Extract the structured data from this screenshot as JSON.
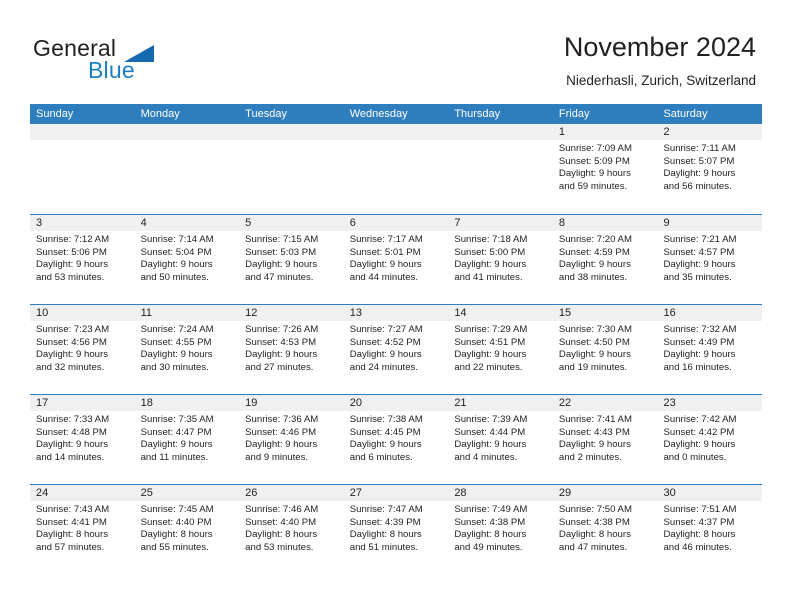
{
  "brand": {
    "word_one": "General",
    "word_two": "Blue",
    "logo_icon": "triangle-logo-icon",
    "accent_color": "#1c7fc4"
  },
  "header": {
    "title": "November 2024",
    "location": "Niederhasli, Zurich, Switzerland"
  },
  "theme": {
    "header_blue": "#2e7ebd",
    "daynum_band": "#f0f0f0",
    "text": "#231f20"
  },
  "weekdays": [
    "Sunday",
    "Monday",
    "Tuesday",
    "Wednesday",
    "Thursday",
    "Friday",
    "Saturday"
  ],
  "weeks": [
    [
      {
        "day": "",
        "empty": true
      },
      {
        "day": "",
        "empty": true
      },
      {
        "day": "",
        "empty": true
      },
      {
        "day": "",
        "empty": true
      },
      {
        "day": "",
        "empty": true
      },
      {
        "day": "1",
        "sunrise": "Sunrise: 7:09 AM",
        "sunset": "Sunset: 5:09 PM",
        "daylight_1": "Daylight: 9 hours",
        "daylight_2": "and 59 minutes."
      },
      {
        "day": "2",
        "sunrise": "Sunrise: 7:11 AM",
        "sunset": "Sunset: 5:07 PM",
        "daylight_1": "Daylight: 9 hours",
        "daylight_2": "and 56 minutes."
      }
    ],
    [
      {
        "day": "3",
        "sunrise": "Sunrise: 7:12 AM",
        "sunset": "Sunset: 5:06 PM",
        "daylight_1": "Daylight: 9 hours",
        "daylight_2": "and 53 minutes."
      },
      {
        "day": "4",
        "sunrise": "Sunrise: 7:14 AM",
        "sunset": "Sunset: 5:04 PM",
        "daylight_1": "Daylight: 9 hours",
        "daylight_2": "and 50 minutes."
      },
      {
        "day": "5",
        "sunrise": "Sunrise: 7:15 AM",
        "sunset": "Sunset: 5:03 PM",
        "daylight_1": "Daylight: 9 hours",
        "daylight_2": "and 47 minutes."
      },
      {
        "day": "6",
        "sunrise": "Sunrise: 7:17 AM",
        "sunset": "Sunset: 5:01 PM",
        "daylight_1": "Daylight: 9 hours",
        "daylight_2": "and 44 minutes."
      },
      {
        "day": "7",
        "sunrise": "Sunrise: 7:18 AM",
        "sunset": "Sunset: 5:00 PM",
        "daylight_1": "Daylight: 9 hours",
        "daylight_2": "and 41 minutes."
      },
      {
        "day": "8",
        "sunrise": "Sunrise: 7:20 AM",
        "sunset": "Sunset: 4:59 PM",
        "daylight_1": "Daylight: 9 hours",
        "daylight_2": "and 38 minutes."
      },
      {
        "day": "9",
        "sunrise": "Sunrise: 7:21 AM",
        "sunset": "Sunset: 4:57 PM",
        "daylight_1": "Daylight: 9 hours",
        "daylight_2": "and 35 minutes."
      }
    ],
    [
      {
        "day": "10",
        "sunrise": "Sunrise: 7:23 AM",
        "sunset": "Sunset: 4:56 PM",
        "daylight_1": "Daylight: 9 hours",
        "daylight_2": "and 32 minutes."
      },
      {
        "day": "11",
        "sunrise": "Sunrise: 7:24 AM",
        "sunset": "Sunset: 4:55 PM",
        "daylight_1": "Daylight: 9 hours",
        "daylight_2": "and 30 minutes."
      },
      {
        "day": "12",
        "sunrise": "Sunrise: 7:26 AM",
        "sunset": "Sunset: 4:53 PM",
        "daylight_1": "Daylight: 9 hours",
        "daylight_2": "and 27 minutes."
      },
      {
        "day": "13",
        "sunrise": "Sunrise: 7:27 AM",
        "sunset": "Sunset: 4:52 PM",
        "daylight_1": "Daylight: 9 hours",
        "daylight_2": "and 24 minutes."
      },
      {
        "day": "14",
        "sunrise": "Sunrise: 7:29 AM",
        "sunset": "Sunset: 4:51 PM",
        "daylight_1": "Daylight: 9 hours",
        "daylight_2": "and 22 minutes."
      },
      {
        "day": "15",
        "sunrise": "Sunrise: 7:30 AM",
        "sunset": "Sunset: 4:50 PM",
        "daylight_1": "Daylight: 9 hours",
        "daylight_2": "and 19 minutes."
      },
      {
        "day": "16",
        "sunrise": "Sunrise: 7:32 AM",
        "sunset": "Sunset: 4:49 PM",
        "daylight_1": "Daylight: 9 hours",
        "daylight_2": "and 16 minutes."
      }
    ],
    [
      {
        "day": "17",
        "sunrise": "Sunrise: 7:33 AM",
        "sunset": "Sunset: 4:48 PM",
        "daylight_1": "Daylight: 9 hours",
        "daylight_2": "and 14 minutes."
      },
      {
        "day": "18",
        "sunrise": "Sunrise: 7:35 AM",
        "sunset": "Sunset: 4:47 PM",
        "daylight_1": "Daylight: 9 hours",
        "daylight_2": "and 11 minutes."
      },
      {
        "day": "19",
        "sunrise": "Sunrise: 7:36 AM",
        "sunset": "Sunset: 4:46 PM",
        "daylight_1": "Daylight: 9 hours",
        "daylight_2": "and 9 minutes."
      },
      {
        "day": "20",
        "sunrise": "Sunrise: 7:38 AM",
        "sunset": "Sunset: 4:45 PM",
        "daylight_1": "Daylight: 9 hours",
        "daylight_2": "and 6 minutes."
      },
      {
        "day": "21",
        "sunrise": "Sunrise: 7:39 AM",
        "sunset": "Sunset: 4:44 PM",
        "daylight_1": "Daylight: 9 hours",
        "daylight_2": "and 4 minutes."
      },
      {
        "day": "22",
        "sunrise": "Sunrise: 7:41 AM",
        "sunset": "Sunset: 4:43 PM",
        "daylight_1": "Daylight: 9 hours",
        "daylight_2": "and 2 minutes."
      },
      {
        "day": "23",
        "sunrise": "Sunrise: 7:42 AM",
        "sunset": "Sunset: 4:42 PM",
        "daylight_1": "Daylight: 9 hours",
        "daylight_2": "and 0 minutes."
      }
    ],
    [
      {
        "day": "24",
        "sunrise": "Sunrise: 7:43 AM",
        "sunset": "Sunset: 4:41 PM",
        "daylight_1": "Daylight: 8 hours",
        "daylight_2": "and 57 minutes."
      },
      {
        "day": "25",
        "sunrise": "Sunrise: 7:45 AM",
        "sunset": "Sunset: 4:40 PM",
        "daylight_1": "Daylight: 8 hours",
        "daylight_2": "and 55 minutes."
      },
      {
        "day": "26",
        "sunrise": "Sunrise: 7:46 AM",
        "sunset": "Sunset: 4:40 PM",
        "daylight_1": "Daylight: 8 hours",
        "daylight_2": "and 53 minutes."
      },
      {
        "day": "27",
        "sunrise": "Sunrise: 7:47 AM",
        "sunset": "Sunset: 4:39 PM",
        "daylight_1": "Daylight: 8 hours",
        "daylight_2": "and 51 minutes."
      },
      {
        "day": "28",
        "sunrise": "Sunrise: 7:49 AM",
        "sunset": "Sunset: 4:38 PM",
        "daylight_1": "Daylight: 8 hours",
        "daylight_2": "and 49 minutes."
      },
      {
        "day": "29",
        "sunrise": "Sunrise: 7:50 AM",
        "sunset": "Sunset: 4:38 PM",
        "daylight_1": "Daylight: 8 hours",
        "daylight_2": "and 47 minutes."
      },
      {
        "day": "30",
        "sunrise": "Sunrise: 7:51 AM",
        "sunset": "Sunset: 4:37 PM",
        "daylight_1": "Daylight: 8 hours",
        "daylight_2": "and 46 minutes."
      }
    ]
  ]
}
